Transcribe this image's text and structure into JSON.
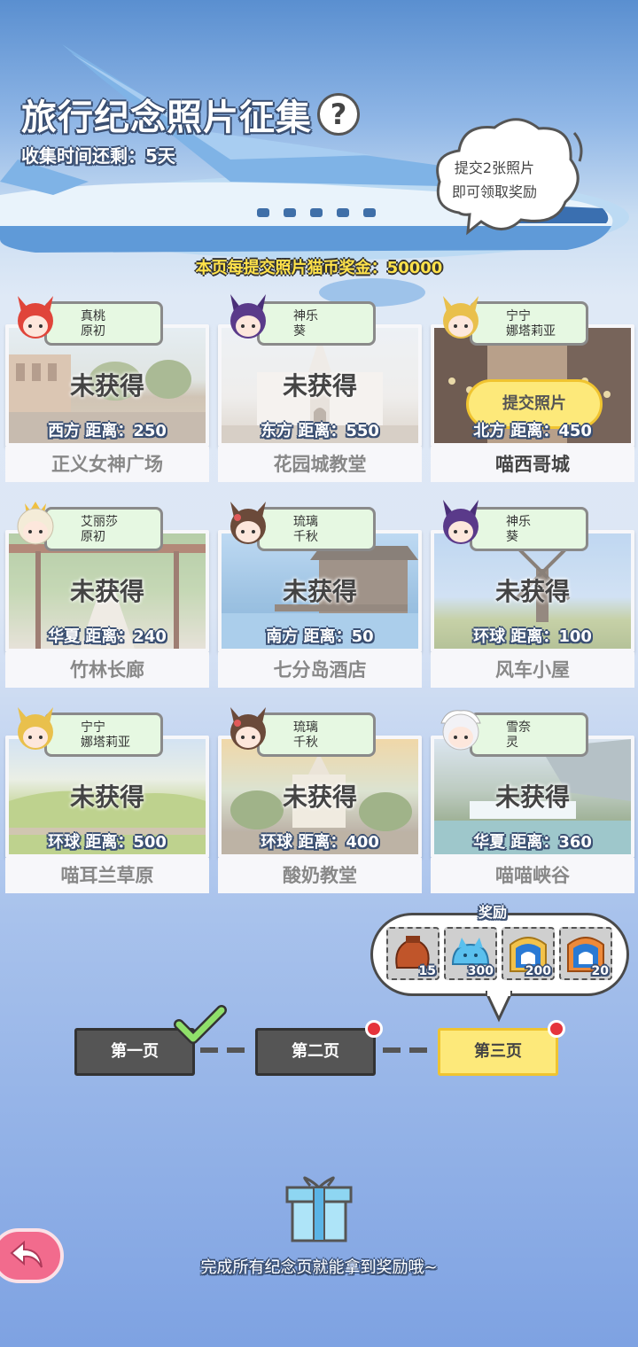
{
  "header": {
    "title": "旅行纪念照片征集",
    "help_label": "?",
    "time_left": "收集时间还剩：5天",
    "bubble_line1": "提交2张照片",
    "bubble_line2": "即可领取奖励",
    "bonus_text": "本页每提交照片猫币奖金：50000"
  },
  "cards": [
    {
      "char1": "真桃",
      "char2": "原初",
      "status": "未获得",
      "distance": "西方  距离：250",
      "place": "正义女神广场",
      "avatar_color": "#e0453a"
    },
    {
      "char1": "神乐",
      "char2": "葵",
      "status": "未获得",
      "distance": "东方  距离：550",
      "place": "花园城教堂",
      "avatar_color": "#5a3a8a"
    },
    {
      "char1": "宁宁",
      "char2": "娜塔莉亚",
      "submit": "提交照片",
      "distance": "北方  距离：450",
      "place": "喵西哥城",
      "avatar_color": "#e9c04c"
    },
    {
      "char1": "艾丽莎",
      "char2": "原初",
      "status": "未获得",
      "distance": "华夏  距离：240",
      "place": "竹林长廊",
      "avatar_color": "#f4ecd8"
    },
    {
      "char1": "琉璃",
      "char2": "千秋",
      "status": "未获得",
      "distance": "南方  距离：50",
      "place": "七分岛酒店",
      "avatar_color": "#6b4a3a"
    },
    {
      "char1": "神乐",
      "char2": "葵",
      "status": "未获得",
      "distance": "环球  距离：100",
      "place": "风车小屋",
      "avatar_color": "#5a3a8a"
    },
    {
      "char1": "宁宁",
      "char2": "娜塔莉亚",
      "status": "未获得",
      "distance": "环球  距离：500",
      "place": "喵耳兰草原",
      "avatar_color": "#e9c04c"
    },
    {
      "char1": "琉璃",
      "char2": "千秋",
      "status": "未获得",
      "distance": "环球  距离：400",
      "place": "酸奶教堂",
      "avatar_color": "#6b4a3a"
    },
    {
      "char1": "雪奈",
      "char2": "灵",
      "status": "未获得",
      "distance": "华夏  距离：360",
      "place": "喵喵峡谷",
      "avatar_color": "#f2f2f6"
    }
  ],
  "rewards": {
    "title": "奖励",
    "items": [
      {
        "count": "15",
        "icon": "food-bag-icon"
      },
      {
        "count": "300",
        "icon": "blue-cat-slime-icon"
      },
      {
        "count": "200",
        "icon": "gold-cat-toast-icon"
      },
      {
        "count": "20",
        "icon": "orange-cat-toast-icon"
      }
    ]
  },
  "pages": [
    {
      "label": "第一页",
      "state": "completed"
    },
    {
      "label": "第二页",
      "state": "notification"
    },
    {
      "label": "第三页",
      "state": "selected"
    }
  ],
  "footer": {
    "complete_text": "完成所有纪念页就能拿到奖励哦~"
  },
  "colors": {
    "accent_yellow": "#fde97a",
    "button_dark": "#555555",
    "tag_green": "#e6f8e2",
    "notification_red": "#e5343c",
    "back_pink": "#f26b8d"
  }
}
